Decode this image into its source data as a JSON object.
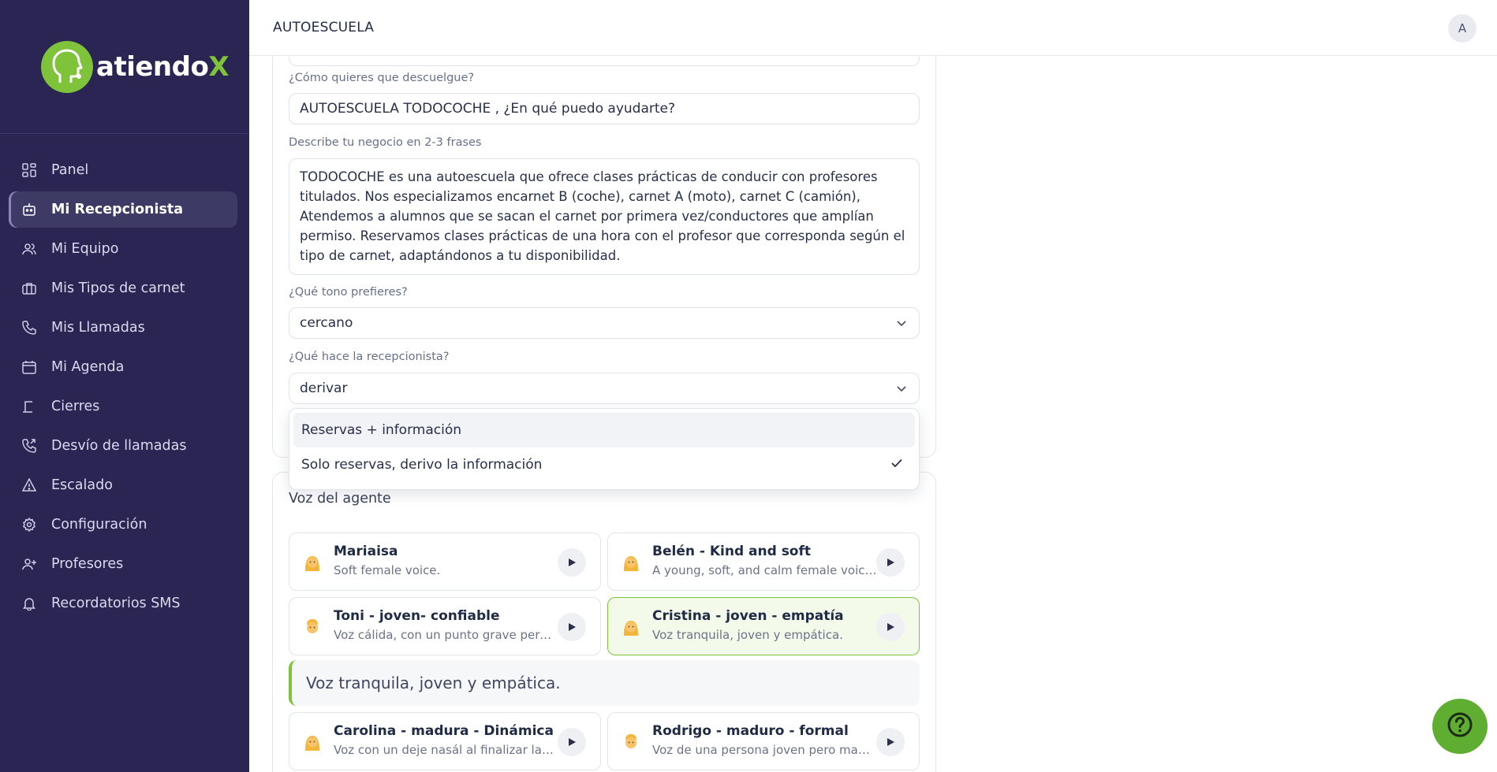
{
  "brand": {
    "name_main": "atiendo",
    "name_accent": "X",
    "accent_color": "#7fc33a",
    "sidebar_color": "#2b2554"
  },
  "sidebar": {
    "items": [
      {
        "label": "Panel",
        "icon": "grid-icon"
      },
      {
        "label": "Mi Recepcionista",
        "icon": "robot-icon",
        "active": true
      },
      {
        "label": "Mi Equipo",
        "icon": "users-icon"
      },
      {
        "label": "Mis Tipos de carnet",
        "icon": "briefcase-icon"
      },
      {
        "label": "Mis Llamadas",
        "icon": "phone-icon"
      },
      {
        "label": "Mi Agenda",
        "icon": "calendar-icon"
      },
      {
        "label": "Cierres",
        "icon": "lamp-icon"
      },
      {
        "label": "Desvío de llamadas",
        "icon": "phone-forward-icon"
      },
      {
        "label": "Escalado",
        "icon": "warning-icon"
      },
      {
        "label": "Configuración",
        "icon": "gear-icon"
      },
      {
        "label": "Profesores",
        "icon": "user-plus-icon"
      },
      {
        "label": "Recordatorios SMS",
        "icon": "bell-icon"
      }
    ]
  },
  "header": {
    "title": "AUTOESCUELA",
    "avatar_initial": "A"
  },
  "form": {
    "greeting_label": "¿Cómo quieres que descuelgue?",
    "greeting_value": "AUTOESCUELA TODOCOCHE , ¿En qué puedo ayudarte?",
    "description_label": "Describe tu negocio en 2-3 frases",
    "description_value": "TODOCOCHE es una autoescuela que ofrece clases prácticas de conducir con profesores titulados. Nos especializamos encarnet B (coche), carnet A (moto), carnet C (camión), Atendemos a alumnos que se sacan el carnet por primera vez/conductores que amplían permiso. Reservamos clases prácticas de una hora con el profesor que corresponda según el tipo de carnet, adaptándonos a tu disponibilidad.",
    "tone_label": "¿Qué tono prefieres?",
    "tone_value": "cercano",
    "role_label": "¿Qué hace la recepcionista?",
    "role_value": "derivar",
    "role_options": [
      {
        "label": "Reservas + información",
        "highlighted": true,
        "selected": false
      },
      {
        "label": "Solo reservas, derivo la información",
        "highlighted": false,
        "selected": true
      }
    ]
  },
  "voices": {
    "title": "Voz del agente",
    "items": [
      {
        "name": "Mariaisa",
        "desc": "Soft female voice.",
        "avatar": "woman-emoji"
      },
      {
        "name": "Belén - Kind and soft",
        "desc": "A young, soft, and calm female voice with a gentle tone",
        "avatar": "woman-emoji"
      },
      {
        "name": "Toni - joven- confiable",
        "desc": "Voz cálida, con un punto grave pero juvenil y confiable",
        "avatar": "man-emoji"
      },
      {
        "name": "Cristina - joven - empatía",
        "desc": "Voz tranquila, joven y empática.",
        "avatar": "woman-emoji",
        "selected": true
      },
      {
        "name": "Carolina - madura - Dinámica",
        "desc": "Voz con un deje nasál al finalizar las palabras",
        "avatar": "woman-emoji"
      },
      {
        "name": "Rodrigo - maduro - formal",
        "desc": "Voz de una persona joven pero madura y formal",
        "avatar": "man-emoji"
      }
    ],
    "selected_preview": "Voz tranquila, joven y empática."
  },
  "help": {
    "icon": "question-icon"
  }
}
